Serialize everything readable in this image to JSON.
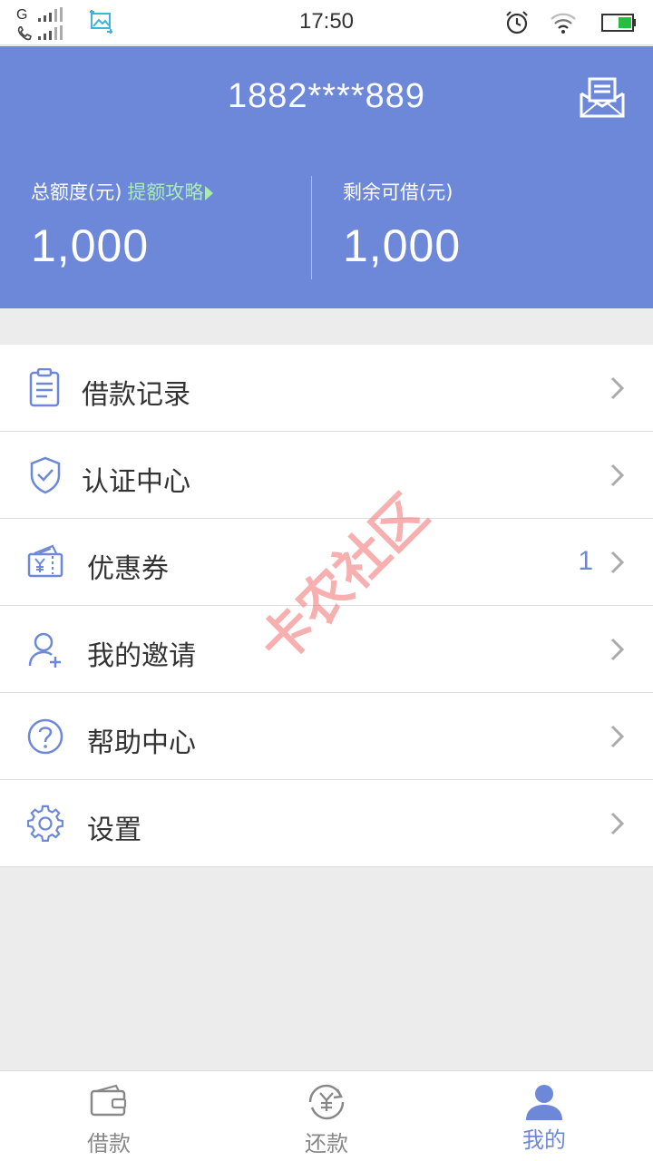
{
  "status_bar": {
    "carrier": "G",
    "time": "17:50",
    "accent": "#5bc0de",
    "battery_color": "#22c03c"
  },
  "header": {
    "phone": "1882****889",
    "bg_color": "#6d88d9",
    "total_label": "总额度(元)",
    "tip_label": "提额攻略",
    "total_value": "1,000",
    "remaining_label": "剩余可借(元)",
    "remaining_value": "1,000",
    "message_icon": "message-inbox-icon"
  },
  "menu": {
    "items": [
      {
        "label": "借款记录",
        "icon": "clipboard-icon"
      },
      {
        "label": "认证中心",
        "icon": "shield-check-icon"
      },
      {
        "label": "优惠券",
        "icon": "coupon-icon",
        "badge": "1"
      },
      {
        "label": "我的邀请",
        "icon": "user-add-icon"
      },
      {
        "label": "帮助中心",
        "icon": "question-icon"
      },
      {
        "label": "设置",
        "icon": "gear-icon"
      }
    ]
  },
  "watermark": "卡农社区",
  "bottom_nav": {
    "items": [
      {
        "label": "借款",
        "icon": "wallet-icon"
      },
      {
        "label": "还款",
        "icon": "yen-refresh-icon"
      },
      {
        "label": "我的",
        "icon": "user-icon",
        "active": true
      }
    ]
  }
}
